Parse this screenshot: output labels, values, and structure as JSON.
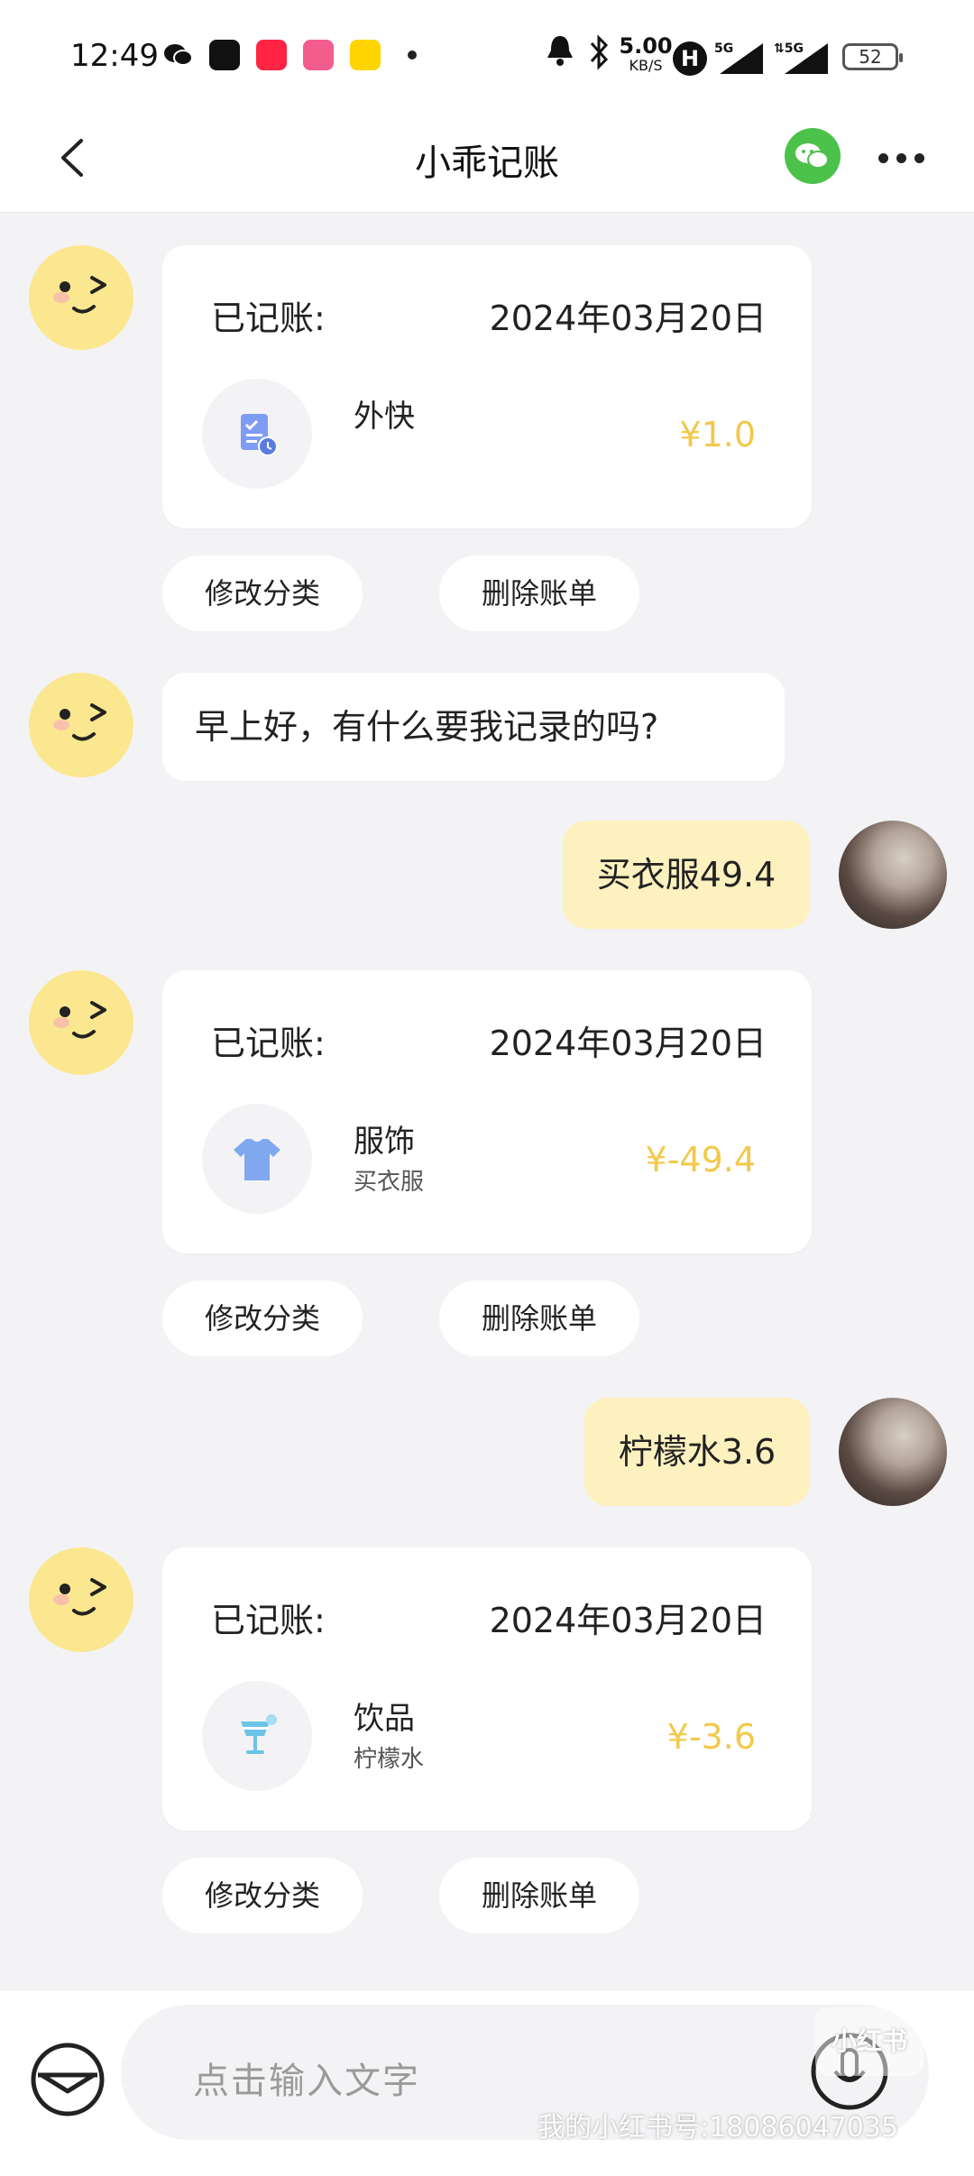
{
  "status_bar": {
    "time": "12:49",
    "net_speed": "5.00",
    "net_unit": "KB/S",
    "h_badge": "H",
    "sig1": "5G",
    "sig2": "5G",
    "battery": "52",
    "app_icons": [
      "wechat-icon",
      "dewu-icon",
      "xiaohongshu-icon",
      "bilibili-icon",
      "qimao-icon"
    ],
    "app_colors": [
      "#ffffff",
      "#111111",
      "#ff2442",
      "#f25d8e",
      "#ffd400"
    ]
  },
  "header": {
    "title": "小乖记账"
  },
  "messages": {
    "card1": {
      "label": "已记账:",
      "date": "2024年03月20日",
      "category": "外快",
      "note": "",
      "amount": "¥1.0",
      "icon": "document-clock-icon"
    },
    "actions1": {
      "modify": "修改分类",
      "delete": "删除账单"
    },
    "greeting": "早上好，有什么要我记录的吗?",
    "user1": "买衣服49.4",
    "card2": {
      "label": "已记账:",
      "date": "2024年03月20日",
      "category": "服饰",
      "note": "买衣服",
      "amount": "¥-49.4",
      "icon": "tshirt-icon"
    },
    "actions2": {
      "modify": "修改分类",
      "delete": "删除账单"
    },
    "user2": "柠檬水3.6",
    "card3": {
      "label": "已记账:",
      "date": "2024年03月20日",
      "category": "饮品",
      "note": "柠檬水",
      "amount": "¥-3.6",
      "icon": "drink-icon"
    },
    "actions3": {
      "modify": "修改分类",
      "delete": "删除账单"
    }
  },
  "input": {
    "placeholder": "点击输入文字"
  },
  "watermark": {
    "logo": "小红书",
    "text": "我的小红书号:18086047035"
  },
  "colors": {
    "accent_amount": "#f2c94c",
    "user_bubble": "#fdf1bf",
    "wechat_green": "#4cc24a"
  }
}
